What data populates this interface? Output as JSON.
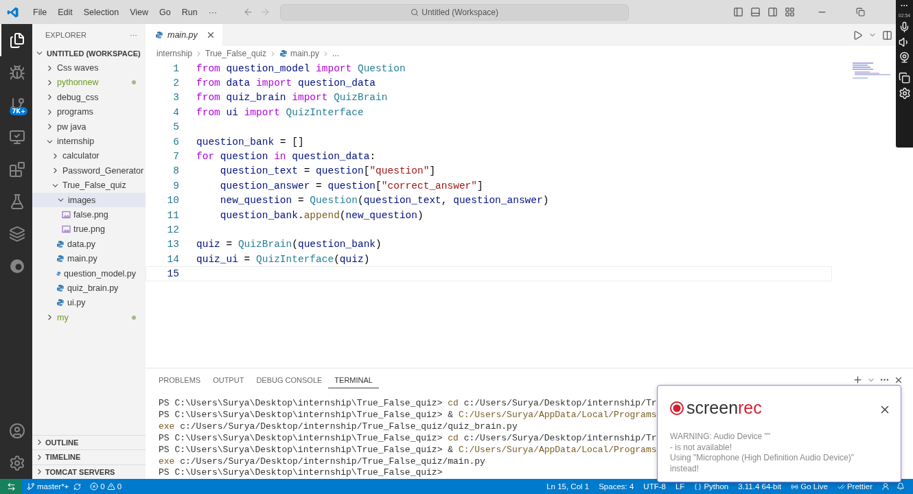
{
  "title_bar": {
    "menus": [
      "File",
      "Edit",
      "Selection",
      "View",
      "Go",
      "Run",
      "···"
    ],
    "search": "Untitled (Workspace)"
  },
  "activity_bar": {
    "items": [
      {
        "kind": "files",
        "selected": true
      },
      {
        "kind": "debug",
        "selected": false
      },
      {
        "kind": "git",
        "selected": false,
        "badge": "7K+"
      },
      {
        "kind": "remote",
        "selected": false
      },
      {
        "kind": "extensions",
        "selected": false
      },
      {
        "kind": "testing",
        "selected": false
      },
      {
        "kind": "layers",
        "selected": false
      },
      {
        "kind": "edge",
        "selected": false
      }
    ],
    "bottom": [
      {
        "kind": "account"
      },
      {
        "kind": "settings"
      }
    ]
  },
  "sidebar": {
    "title": "EXPLORER",
    "more": "···",
    "workspace": {
      "label": "UNTITLED (WORKSPACE)",
      "expanded": true
    },
    "tree": [
      {
        "label": "Css waves",
        "kind": "folder",
        "expanded": false,
        "selected": false,
        "untracked": false
      },
      {
        "label": "pythonnew",
        "kind": "folder",
        "expanded": false,
        "selected": false,
        "untracked": true
      },
      {
        "label": "debug_css",
        "kind": "folder",
        "expanded": false,
        "selected": false,
        "untracked": false
      },
      {
        "label": "programs",
        "kind": "folder",
        "expanded": false,
        "selected": false,
        "untracked": false
      },
      {
        "label": "pw java",
        "kind": "folder",
        "expanded": false,
        "selected": false,
        "untracked": false
      },
      {
        "label": "internship",
        "kind": "folder",
        "expanded": true,
        "selected": false,
        "untracked": false,
        "children": [
          {
            "label": "calculator",
            "kind": "folder",
            "expanded": false,
            "selected": false,
            "untracked": false
          },
          {
            "label": "Password_Generator",
            "kind": "folder",
            "expanded": false,
            "selected": false,
            "untracked": false
          },
          {
            "label": "True_False_quiz",
            "kind": "folder",
            "expanded": true,
            "selected": false,
            "untracked": false,
            "children": [
              {
                "label": "images",
                "kind": "folder",
                "expanded": true,
                "selected": true,
                "untracked": false,
                "children": [
                  {
                    "label": "false.png",
                    "kind": "image",
                    "selected": false,
                    "untracked": false
                  },
                  {
                    "label": "true.png",
                    "kind": "image",
                    "selected": false,
                    "untracked": false
                  }
                ]
              },
              {
                "label": "data.py",
                "kind": "python",
                "selected": false,
                "untracked": false
              },
              {
                "label": "main.py",
                "kind": "python",
                "selected": false,
                "untracked": false
              },
              {
                "label": "question_model.py",
                "kind": "python",
                "selected": false,
                "untracked": false
              },
              {
                "label": "quiz_brain.py",
                "kind": "python",
                "selected": false,
                "untracked": false
              },
              {
                "label": "ui.py",
                "kind": "python",
                "selected": false,
                "untracked": false
              }
            ]
          }
        ]
      },
      {
        "label": "my",
        "kind": "folder",
        "expanded": false,
        "selected": false,
        "untracked": true
      }
    ],
    "sections": [
      {
        "label": "OUTLINE",
        "expanded": false
      },
      {
        "label": "TIMELINE",
        "expanded": false
      },
      {
        "label": "TOMCAT SERVERS",
        "expanded": false
      }
    ]
  },
  "editor": {
    "tabs": [
      {
        "label": "main.py",
        "selected": true
      }
    ],
    "breadcrumbs": [
      "internship",
      "True_False_quiz",
      "main.py",
      "..."
    ],
    "lines": [
      {
        "number": "1",
        "current": false,
        "tokens": [
          {
            "kind": "keyword",
            "text": "from "
          },
          {
            "kind": "variable",
            "text": "question_model "
          },
          {
            "kind": "keyword",
            "text": "import "
          },
          {
            "kind": "class",
            "text": "Question"
          }
        ]
      },
      {
        "number": "2",
        "current": false,
        "tokens": [
          {
            "kind": "keyword",
            "text": "from "
          },
          {
            "kind": "variable",
            "text": "data "
          },
          {
            "kind": "keyword",
            "text": "import "
          },
          {
            "kind": "variable",
            "text": "question_data"
          }
        ]
      },
      {
        "number": "3",
        "current": false,
        "tokens": [
          {
            "kind": "keyword",
            "text": "from "
          },
          {
            "kind": "variable",
            "text": "quiz_brain "
          },
          {
            "kind": "keyword",
            "text": "import "
          },
          {
            "kind": "class",
            "text": "QuizBrain"
          }
        ]
      },
      {
        "number": "4",
        "current": false,
        "tokens": [
          {
            "kind": "keyword",
            "text": "from "
          },
          {
            "kind": "variable",
            "text": "ui "
          },
          {
            "kind": "keyword",
            "text": "import "
          },
          {
            "kind": "class",
            "text": "QuizInterface"
          }
        ]
      },
      {
        "number": "5",
        "current": false
      },
      {
        "number": "6",
        "current": false,
        "tokens": [
          {
            "kind": "variable",
            "text": "question_bank"
          },
          {
            "kind": "plain",
            "text": " = []"
          }
        ]
      },
      {
        "number": "7",
        "current": false,
        "tokens": [
          {
            "kind": "keyword",
            "text": "for "
          },
          {
            "kind": "variable",
            "text": "question "
          },
          {
            "kind": "keyword",
            "text": "in "
          },
          {
            "kind": "variable",
            "text": "question_data"
          },
          {
            "kind": "plain",
            "text": ":"
          }
        ]
      },
      {
        "number": "8",
        "current": false,
        "tokens": [
          {
            "kind": "variable",
            "text": "    question_text"
          },
          {
            "kind": "plain",
            "text": " = "
          },
          {
            "kind": "variable",
            "text": "question"
          },
          {
            "kind": "plain",
            "text": "["
          },
          {
            "kind": "string",
            "text": "\"question\""
          },
          {
            "kind": "plain",
            "text": "]"
          }
        ]
      },
      {
        "number": "9",
        "current": false,
        "tokens": [
          {
            "kind": "variable",
            "text": "    question_answer"
          },
          {
            "kind": "plain",
            "text": " = "
          },
          {
            "kind": "variable",
            "text": "question"
          },
          {
            "kind": "plain",
            "text": "["
          },
          {
            "kind": "string",
            "text": "\"correct_answer\""
          },
          {
            "kind": "plain",
            "text": "]"
          }
        ]
      },
      {
        "number": "10",
        "current": false,
        "tokens": [
          {
            "kind": "variable",
            "text": "    new_question"
          },
          {
            "kind": "plain",
            "text": " = "
          },
          {
            "kind": "class",
            "text": "Question"
          },
          {
            "kind": "plain",
            "text": "("
          },
          {
            "kind": "variable",
            "text": "question_text"
          },
          {
            "kind": "plain",
            "text": ", "
          },
          {
            "kind": "variable",
            "text": "question_answer"
          },
          {
            "kind": "plain",
            "text": ")"
          }
        ]
      },
      {
        "number": "11",
        "current": false,
        "tokens": [
          {
            "kind": "variable",
            "text": "    question_bank"
          },
          {
            "kind": "plain",
            "text": "."
          },
          {
            "kind": "function",
            "text": "append"
          },
          {
            "kind": "plain",
            "text": "("
          },
          {
            "kind": "variable",
            "text": "new_question"
          },
          {
            "kind": "plain",
            "text": ")"
          }
        ]
      },
      {
        "number": "12",
        "current": false
      },
      {
        "number": "13",
        "current": false,
        "tokens": [
          {
            "kind": "variable",
            "text": "quiz"
          },
          {
            "kind": "plain",
            "text": " = "
          },
          {
            "kind": "class",
            "text": "QuizBrain"
          },
          {
            "kind": "plain",
            "text": "("
          },
          {
            "kind": "variable",
            "text": "question_bank"
          },
          {
            "kind": "plain",
            "text": ")"
          }
        ]
      },
      {
        "number": "14",
        "current": false,
        "tokens": [
          {
            "kind": "variable",
            "text": "quiz_ui"
          },
          {
            "kind": "plain",
            "text": " = "
          },
          {
            "kind": "class",
            "text": "QuizInterface"
          },
          {
            "kind": "plain",
            "text": "("
          },
          {
            "kind": "variable",
            "text": "quiz"
          },
          {
            "kind": "plain",
            "text": ")"
          }
        ]
      },
      {
        "number": "15",
        "current": true
      }
    ]
  },
  "panel": {
    "tabs": [
      {
        "label": "PROBLEMS",
        "selected": false
      },
      {
        "label": "OUTPUT",
        "selected": false
      },
      {
        "label": "DEBUG CONSOLE",
        "selected": false
      },
      {
        "label": "TERMINAL",
        "selected": true
      }
    ],
    "terminal": [
      [
        {
          "kind": "plain",
          "text": "PS C:\\Users\\Surya\\Desktop\\internship\\True_False_quiz> "
        },
        {
          "kind": "command",
          "text": "cd"
        },
        {
          "kind": "plain",
          "text": " c:/Users/Surya/Desktop/internship/Tr"
        }
      ],
      [
        {
          "kind": "plain",
          "text": "PS C:\\Users\\Surya\\Desktop\\internship\\True_False_quiz> & "
        },
        {
          "kind": "command",
          "text": "C:/Users/Surya/AppData/Local/Programs"
        }
      ],
      [
        {
          "kind": "command",
          "text": "exe"
        },
        {
          "kind": "plain",
          "text": " c:/Users/Surya/Desktop/internship/True_False_quiz/quiz_brain.py"
        }
      ],
      [
        {
          "kind": "plain",
          "text": "PS C:\\Users\\Surya\\Desktop\\internship\\True_False_quiz> "
        },
        {
          "kind": "command",
          "text": "cd"
        },
        {
          "kind": "plain",
          "text": " c:/Users/Surya/Desktop/internship/Tr"
        }
      ],
      [
        {
          "kind": "plain",
          "text": "PS C:\\Users\\Surya\\Desktop\\internship\\True_False_quiz> & "
        },
        {
          "kind": "command",
          "text": "C:/Users/Surya/AppData/Local/Programs"
        }
      ],
      [
        {
          "kind": "command",
          "text": "exe"
        },
        {
          "kind": "plain",
          "text": " c:/Users/Surya/Desktop/internship/True_False_quiz/main.py"
        }
      ],
      [
        {
          "kind": "plain",
          "text": "PS C:\\Users\\Surya\\Desktop\\internship\\True_False_quiz>"
        }
      ]
    ]
  },
  "status_bar": {
    "branch": "master*+",
    "errors": "0",
    "warnings": "0",
    "right": [
      "Ln 15, Col 1",
      "Spaces: 4",
      "UTF-8",
      "LF",
      "Python",
      "3.11.4 64-bit",
      "Go Live",
      "Prettier"
    ]
  },
  "recorder": {
    "time": "02:54",
    "more": "···"
  },
  "popup": {
    "logo": "screen",
    "logo_accent": "rec",
    "lines": [
      "WARNING: Audio Device \"\"",
      "- is not available!",
      "Using \"Microphone (High Definition Audio Device)\"",
      "instead!"
    ]
  }
}
